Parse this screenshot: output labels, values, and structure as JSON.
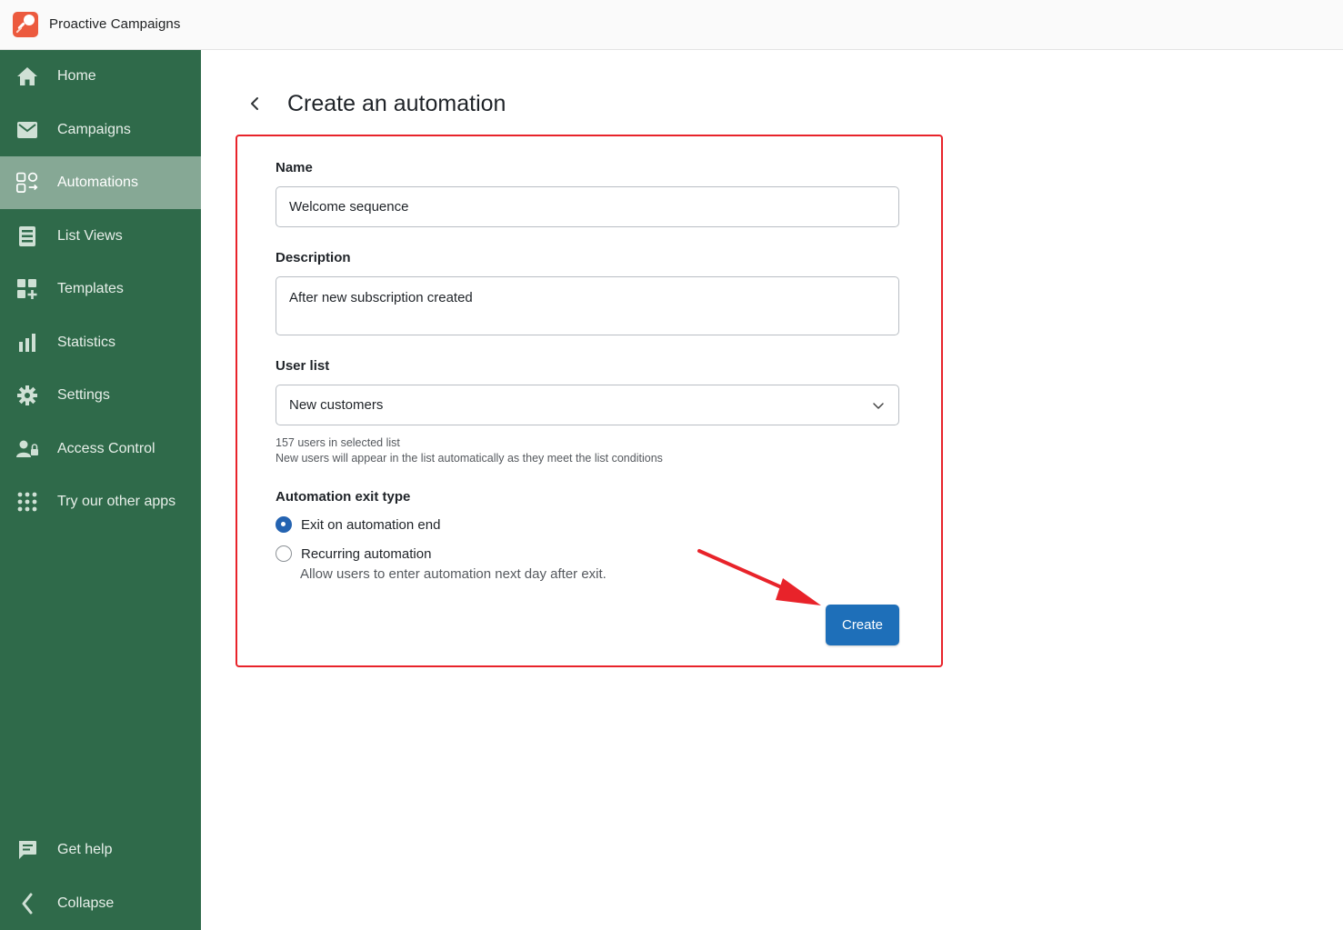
{
  "app": {
    "title": "Proactive Campaigns"
  },
  "sidebar": {
    "items": [
      {
        "label": "Home",
        "icon": "home-icon"
      },
      {
        "label": "Campaigns",
        "icon": "envelope-icon"
      },
      {
        "label": "Automations",
        "icon": "automations-icon",
        "active": true
      },
      {
        "label": "List Views",
        "icon": "list-views-icon"
      },
      {
        "label": "Templates",
        "icon": "templates-icon"
      },
      {
        "label": "Statistics",
        "icon": "bar-chart-icon"
      },
      {
        "label": "Settings",
        "icon": "gear-icon"
      },
      {
        "label": "Access Control",
        "icon": "user-lock-icon"
      },
      {
        "label": "Try our other apps",
        "icon": "apps-grid-icon"
      }
    ],
    "bottom": [
      {
        "label": "Get help",
        "icon": "chat-icon"
      },
      {
        "label": "Collapse",
        "icon": "chevron-left-icon"
      }
    ]
  },
  "page": {
    "title": "Create an automation"
  },
  "form": {
    "name_label": "Name",
    "name_value": "Welcome sequence",
    "description_label": "Description",
    "description_value": "After new subscription created",
    "user_list_label": "User list",
    "user_list_value": "New customers",
    "user_list_help1": "157 users in selected list",
    "user_list_help2": "New users will appear in the list automatically as they meet the list conditions",
    "exit_type_label": "Automation exit type",
    "exit_options": [
      {
        "label": "Exit on automation end",
        "checked": true
      },
      {
        "label": "Recurring automation",
        "checked": false,
        "help": "Allow users to enter automation next day after exit."
      }
    ],
    "create_label": "Create"
  },
  "colors": {
    "sidebar": "#2f6a4a",
    "sidebar_active": "#86a895",
    "primary": "#1e6fb9",
    "highlight": "#e8232a",
    "brand": "#ec5a3e"
  }
}
